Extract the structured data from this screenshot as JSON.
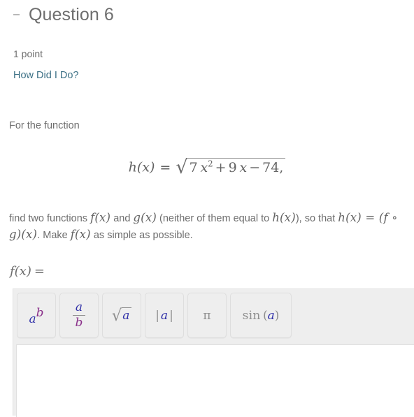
{
  "header": {
    "collapse_icon": "minus-icon",
    "title": "Question 6"
  },
  "meta": {
    "points": "1 point",
    "how_did_i_do_label": "How Did I Do?",
    "link_color": "#3c7085"
  },
  "prose": {
    "intro": "For the function",
    "task_line1_a": "find two functions ",
    "task_fx": "f(x)",
    "task_line1_b": " and ",
    "task_gx": "g(x)",
    "task_line1_c": " (neither of them equal to ",
    "task_hx": "h(x)",
    "task_line1_d": "), so that",
    "task_line2_eq": "h(x) = (f ∘ g)(x)",
    "task_line2_b": ". Make ",
    "task_fx2": "f(x)",
    "task_line2_c": " as simple as possible."
  },
  "equation": {
    "lhs": "h(x)",
    "relation": "=",
    "radical_sign": "√",
    "radicand_coeff": "7",
    "radicand_var": "x",
    "radicand_exp": "2",
    "radicand_op1": "+",
    "radicand_term2_coeff": "9",
    "radicand_term2_var": "x",
    "radicand_op2": "−",
    "radicand_const": "74,"
  },
  "answer": {
    "label_fx": "f(x)",
    "label_equals": "="
  },
  "math_toolbar": {
    "buttons": [
      {
        "name": "power",
        "base": "a",
        "exponent": "b"
      },
      {
        "name": "fraction",
        "numerator": "a",
        "denominator": "b"
      },
      {
        "name": "square-root",
        "sign": "√",
        "radicand": "a"
      },
      {
        "name": "absolute-value",
        "left_bar": "|",
        "operand": "a",
        "right_bar": "|"
      },
      {
        "name": "pi",
        "symbol": "π"
      },
      {
        "name": "sine",
        "function": "sin",
        "open_paren": "(",
        "operand": "a",
        "close_paren": ")"
      }
    ],
    "colors": {
      "variable_a": "#2f2fa8",
      "variable_b": "#8a2f8a",
      "operator": "#8e8e8e",
      "button_bg": "#eeeeee",
      "button_border": "#dedede",
      "panel_bg": "#eeeeee"
    }
  },
  "input": {
    "value": ""
  }
}
